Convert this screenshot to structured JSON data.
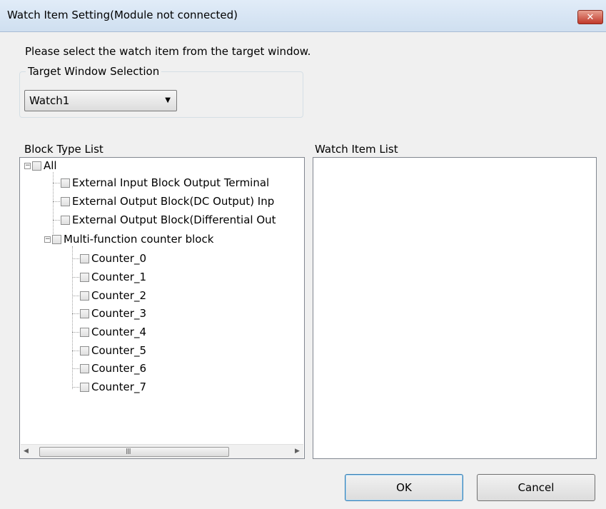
{
  "window": {
    "title": "Watch Item Setting(Module not connected)",
    "close_symbol": "✕"
  },
  "instruction": "Please select the watch item from the target window.",
  "target_window": {
    "legend": "Target Window Selection",
    "selected": "Watch1",
    "arrow": "▼"
  },
  "block_type_list": {
    "label": "Block Type List",
    "root": {
      "label": "All",
      "expander": "−"
    },
    "items": [
      "External Input Block Output Terminal",
      "External Output Block(DC Output) Inp",
      "External Output Block(Differential Out"
    ],
    "counter_group": {
      "label": "Multi-function counter block",
      "expander": "−",
      "children": [
        "Counter_0",
        "Counter_1",
        "Counter_2",
        "Counter_3",
        "Counter_4",
        "Counter_5",
        "Counter_6",
        "Counter_7"
      ]
    },
    "scroll": {
      "left": "◀",
      "right": "▶",
      "grip": "III"
    }
  },
  "watch_item_list": {
    "label": "Watch Item List"
  },
  "buttons": {
    "ok": "OK",
    "cancel": "Cancel"
  }
}
